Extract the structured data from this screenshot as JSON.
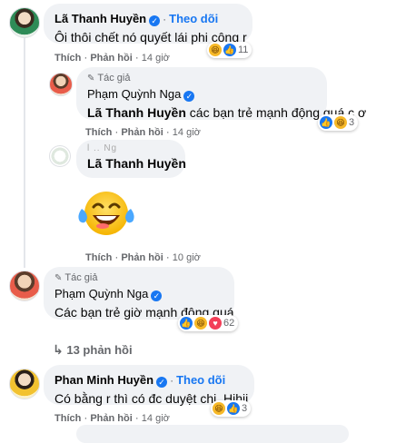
{
  "comments": [
    {
      "name": "Lã Thanh Huyền",
      "follow": "Theo dõi",
      "text": "Ôi thôi chết nó quyết lái phi công r",
      "like_label": "Thích",
      "reply_label": "Phản hồi",
      "time": "14 giờ",
      "reaction_count": "11"
    },
    {
      "author_badge": "Tác giả",
      "name": "Phạm Quỳnh Nga",
      "tag": "Lã Thanh Huyền",
      "text": "các bạn trẻ mạnh động quá c ơ",
      "like_label": "Thích",
      "reply_label": "Phản hồi",
      "time": "14 giờ",
      "reaction_count": "3"
    },
    {
      "name_obscured": "l .. Ng",
      "tag": "Lã Thanh Huyền",
      "sticker": "laughing-crying-emoji",
      "like_label": "Thích",
      "reply_label": "Phản hồi",
      "time": "10 giờ"
    },
    {
      "author_badge": "Tác giả",
      "name": "Phạm Quỳnh Nga",
      "text": "Các bạn trẻ giờ mạnh động quá",
      "like_label": "Thích",
      "reply_label": "Phản hồi",
      "time": "14 giờ",
      "reaction_count": "62"
    },
    {
      "replies_label": "13 phản hồi"
    },
    {
      "name": "Phan Minh Huyền",
      "follow": "Theo dõi",
      "text": "Có bằng r thì có đc duyệt chị. Hihii",
      "like_label": "Thích",
      "reply_label": "Phản hồi",
      "time": "14 giờ",
      "reaction_count": "3"
    }
  ],
  "colors": {
    "link_blue": "#1877f2",
    "bubble_bg": "#f0f2f5",
    "meta_gray": "#65676b"
  }
}
